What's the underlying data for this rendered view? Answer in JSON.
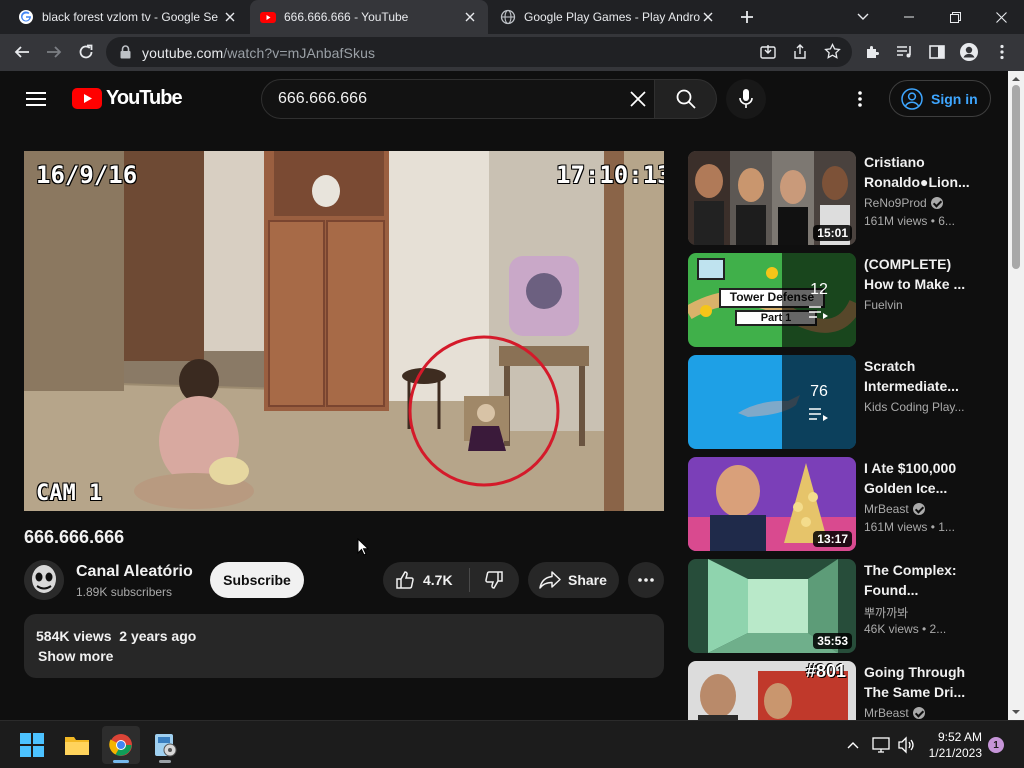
{
  "browser": {
    "tabs": [
      {
        "title": "black forest vzlom tv - Google Se",
        "icon": "google-icon",
        "active": false
      },
      {
        "title": "666.666.666 - YouTube",
        "icon": "youtube-icon",
        "active": true
      },
      {
        "title": "Google Play Games - Play Androi",
        "icon": "globe-icon",
        "active": false
      }
    ],
    "url_host": "youtube.com",
    "url_path": "/watch?v=mJAnbafSkus"
  },
  "masthead": {
    "logo_text": "YouTube",
    "search_value": "666.666.666",
    "signin_label": "Sign in"
  },
  "player": {
    "overlay_date": "16/9/16",
    "overlay_time": "17:10:13",
    "overlay_cam": "CAM 1"
  },
  "video": {
    "title": "666.666.666",
    "channel": "Canal Aleatório",
    "subscribers": "1.89K subscribers",
    "subscribe_label": "Subscribe",
    "likes": "4.7K",
    "share_label": "Share",
    "views_date": "584K views  2 years ago",
    "show_more": "Show more"
  },
  "recommendations": [
    {
      "title": "Cristiano Ronaldo●Lion...",
      "channel": "ReNo9Prod",
      "verified": true,
      "meta": "161M views • 6...",
      "duration": "15:01"
    },
    {
      "title": "(COMPLETE) How to Make ...",
      "channel": "Fuelvin",
      "verified": false,
      "meta": "",
      "playlist_count": "12",
      "thumb_text_1": "Tower Defense",
      "thumb_text_2": "Part 1"
    },
    {
      "title": "Scratch Intermediate...",
      "channel": "Kids Coding Play...",
      "verified": false,
      "meta": "",
      "playlist_count": "76"
    },
    {
      "title": "I Ate $100,000 Golden Ice...",
      "channel": "MrBeast",
      "verified": true,
      "meta": "161M views • 1...",
      "duration": "13:17"
    },
    {
      "title": "The Complex: Found...",
      "channel": "뿌까까봐",
      "verified": false,
      "meta": "46K views • 2...",
      "duration": "35:53"
    },
    {
      "title": "Going Through The Same Dri...",
      "channel": "MrBeast",
      "verified": true,
      "meta": "",
      "thumb_text_1": "#801"
    }
  ],
  "taskbar": {
    "time": "9:52 AM",
    "date": "1/21/2023",
    "notification_count": "1"
  },
  "colors": {
    "accent_blue": "#3ea6ff",
    "youtube_red": "#ff0000",
    "background": "#0f0f0f",
    "surface": "#272727"
  }
}
